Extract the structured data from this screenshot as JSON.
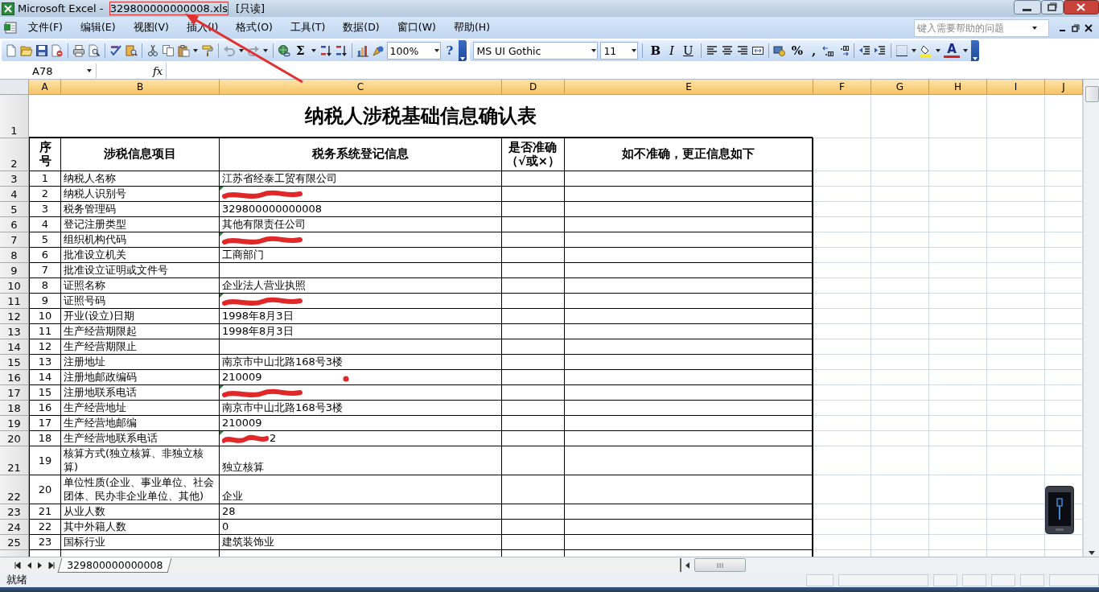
{
  "window": {
    "title": "Microsoft Excel - ",
    "file_name": "329800000000008.xls",
    "file_highlighted": true,
    "mode": "[只读]"
  },
  "menu": [
    "文件(F)",
    "编辑(E)",
    "视图(V)",
    "插入(I)",
    "格式(O)",
    "工具(T)",
    "数据(D)",
    "窗口(W)",
    "帮助(H)"
  ],
  "help_box": {
    "placeholder": "键入需要帮助的问题"
  },
  "standard_toolbar": {
    "autosum": "Σ",
    "zoom": "100%",
    "help": "?"
  },
  "formatting_toolbar": {
    "font": "MS UI Gothic",
    "size": "11",
    "bold": "B",
    "italic": "I",
    "underline": "U",
    "percent": "%",
    "comma": ",",
    "font_color": "A"
  },
  "formula_bar": {
    "name_box": "A78",
    "function": "fx"
  },
  "columns": [
    "A",
    "B",
    "C",
    "D",
    "E",
    "F",
    "G",
    "H",
    "I",
    "J"
  ],
  "sheet": {
    "title_row": "1",
    "title": "纳税人涉税基础信息确认表",
    "header": {
      "number": "2",
      "seq": "序号",
      "item": "涉税信息项目",
      "registered": "税务系统登记信息",
      "accurate": [
        "是否准确",
        "（√或×）"
      ],
      "correction": "如不准确，更正信息如下"
    },
    "rows": [
      {
        "number": "3",
        "seq": "1",
        "item": "纳税人名称",
        "value": "江苏省经泰工贸有限公司"
      },
      {
        "number": "4",
        "seq": "2",
        "item": "纳税人识别号",
        "redacted": true,
        "text_marker": true
      },
      {
        "number": "5",
        "seq": "3",
        "item": "税务管理码",
        "value": "329800000000008"
      },
      {
        "number": "6",
        "seq": "4",
        "item": "登记注册类型",
        "value": "其他有限责任公司"
      },
      {
        "number": "7",
        "seq": "5",
        "item": "组织机构代码",
        "redacted": true,
        "text_marker": true
      },
      {
        "number": "8",
        "seq": "6",
        "item": "批准设立机关",
        "value": "工商部门"
      },
      {
        "number": "9",
        "seq": "7",
        "item": "批准设立证明或文件号"
      },
      {
        "number": "10",
        "seq": "8",
        "item": "证照名称",
        "value": "企业法人营业执照"
      },
      {
        "number": "11",
        "seq": "9",
        "item": "证照号码",
        "redacted": true,
        "text_marker": true
      },
      {
        "number": "12",
        "seq": "10",
        "item": "开业(设立)日期",
        "value": "1998年8月3日"
      },
      {
        "number": "13",
        "seq": "11",
        "item": "生产经营期限起",
        "value": "1998年8月3日"
      },
      {
        "number": "14",
        "seq": "12",
        "item": "生产经营期限止"
      },
      {
        "number": "15",
        "seq": "13",
        "item": "注册地址",
        "value": "南京市中山北路168号3楼"
      },
      {
        "number": "16",
        "seq": "14",
        "item": "注册地邮政编码",
        "value": "210009"
      },
      {
        "number": "17",
        "seq": "15",
        "item": "注册地联系电话",
        "redacted": true,
        "text_marker": true
      },
      {
        "number": "18",
        "seq": "16",
        "item": "生产经营地址",
        "value": "南京市中山北路168号3楼"
      },
      {
        "number": "19",
        "seq": "17",
        "item": "生产经营地邮编",
        "value": "210009"
      },
      {
        "number": "20",
        "seq": "18",
        "item": "生产经营地联系电话",
        "value": "2",
        "redacted": true,
        "text_marker": true
      },
      {
        "number": "21",
        "seq": "19",
        "item": "核算方式(独立核算、非独立核算)",
        "value": "独立核算"
      },
      {
        "number": "22",
        "seq": "20",
        "item": "单位性质(企业、事业单位、社会团体、民办非企业单位、其他)",
        "value": "企业"
      },
      {
        "number": "23",
        "seq": "21",
        "item": "从业人数",
        "value": "28"
      },
      {
        "number": "24",
        "seq": "22",
        "item": "其中外籍人数",
        "value": "0"
      },
      {
        "number": "25",
        "seq": "23",
        "item": "国标行业",
        "value": "建筑装饰业"
      }
    ]
  },
  "sheet_tabs": [
    {
      "label": "329800000000008",
      "selected": true
    }
  ],
  "status_bar": {
    "text": "就绪"
  }
}
